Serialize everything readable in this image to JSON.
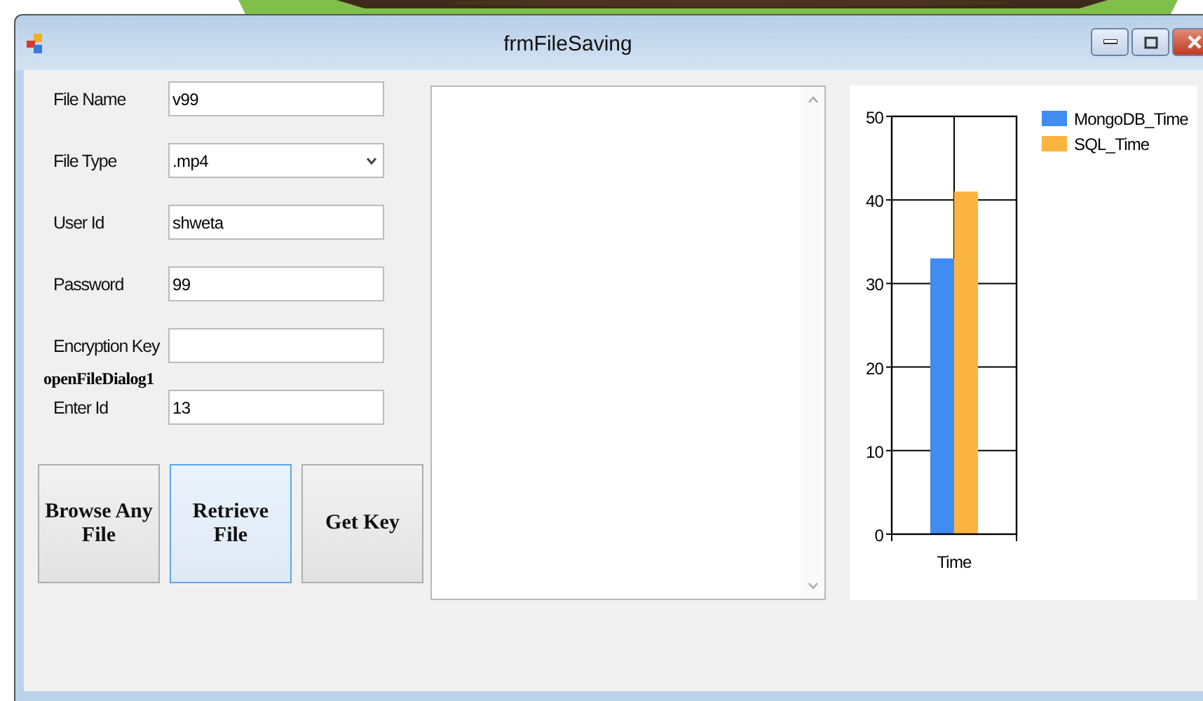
{
  "window": {
    "title": "frmFileSaving"
  },
  "fields": [
    {
      "label": "File Name",
      "kind": "text",
      "value": "v99"
    },
    {
      "label": "File Type",
      "kind": "dropdown",
      "value": ".mp4"
    },
    {
      "label": "User Id",
      "kind": "text",
      "value": "shweta"
    },
    {
      "label": "Password",
      "kind": "text",
      "value": "99"
    },
    {
      "label": "Encryption Key",
      "kind": "text"
    },
    {
      "label": "Enter Id",
      "kind": "text",
      "value": "13"
    }
  ],
  "component_tray_label": "openFileDialog1",
  "buttons": [
    {
      "label": "Browse Any File",
      "focused": false
    },
    {
      "label": "Retrieve File",
      "focused": true
    },
    {
      "label": "Get Key",
      "focused": false
    }
  ],
  "chart_data": {
    "type": "bar",
    "categories": [
      "Time"
    ],
    "series": [
      {
        "name": "MongoDB_Time",
        "color": "#418cf0",
        "values": [
          33
        ]
      },
      {
        "name": "SQL_Time",
        "color": "#fcb441",
        "values": [
          41
        ]
      }
    ],
    "grid": true,
    "legend": true,
    "ylim": [
      0,
      50
    ],
    "yticks": [
      0,
      10,
      20,
      30,
      40,
      50
    ]
  }
}
